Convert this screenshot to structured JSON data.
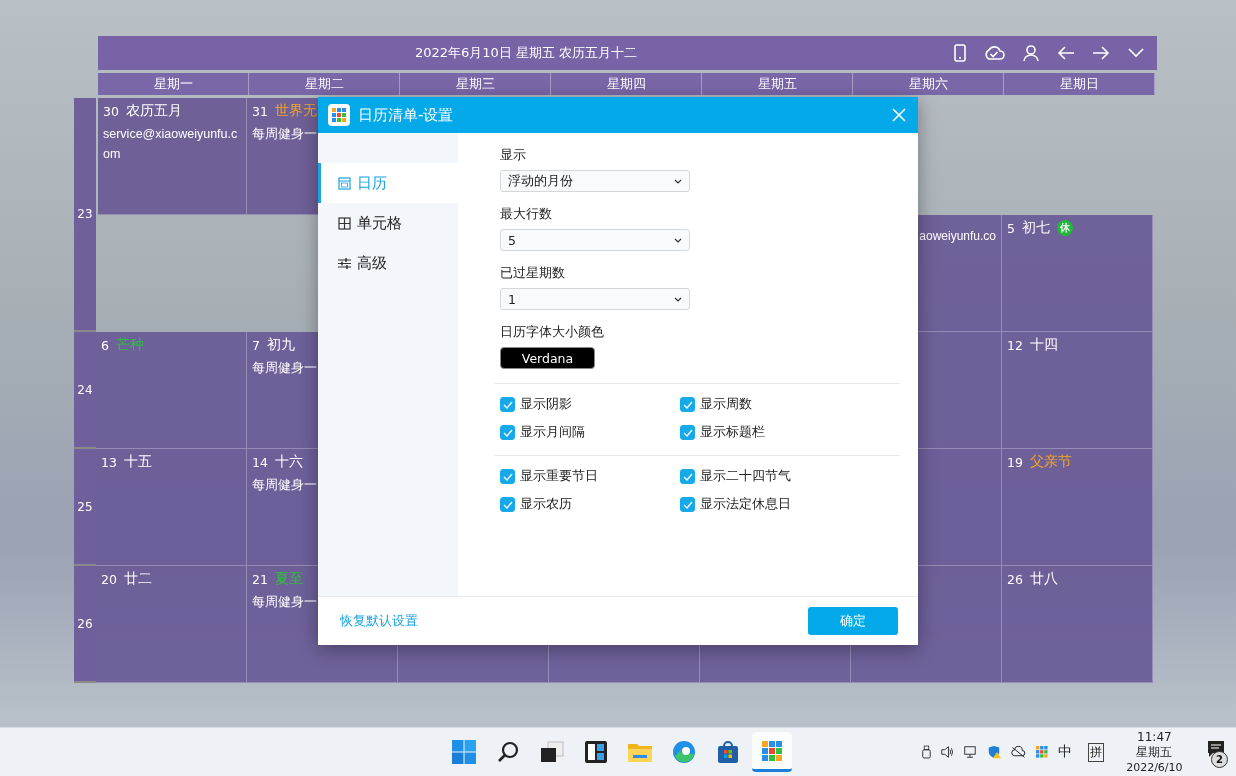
{
  "calendar": {
    "title": "2022年6月10日 星期五 农历五月十二",
    "toolbar": [
      {
        "kind": "phone"
      },
      {
        "kind": "cloud-check"
      },
      {
        "kind": "person"
      },
      {
        "kind": "arrow-left"
      },
      {
        "kind": "arrow-right"
      },
      {
        "kind": "chevron-down"
      }
    ],
    "weekdays": [
      "星期一",
      "星期二",
      "星期三",
      "星期四",
      "星期五",
      "星期六",
      "星期日"
    ],
    "weeks": [
      {
        "number": "23",
        "split": true,
        "days": [
          {
            "kind": "prev",
            "date": "30",
            "label": "农历五月",
            "color": "#ffffff",
            "event": "service@xiaoweiyunfu.com"
          },
          {
            "kind": "prev",
            "date": "31",
            "label": "世界无",
            "color": "#f5a623",
            "event": "每周健身一"
          },
          {
            "kind": "current"
          },
          {
            "kind": "current"
          },
          {
            "kind": "current"
          },
          {
            "kind": "current",
            "event": "aoweiyunfu.co",
            "covered": true
          },
          {
            "kind": "current",
            "date": "5",
            "label": "初七",
            "color": "#ffffff",
            "badge": "休"
          }
        ]
      },
      {
        "number": "24",
        "split": false,
        "days": [
          {
            "kind": "current",
            "date": "6",
            "label": "芒种",
            "color": "#2ec23a"
          },
          {
            "kind": "current",
            "date": "7",
            "label": "初九",
            "color": "#ffffff",
            "event": "每周健身一"
          },
          {
            "kind": "current"
          },
          {
            "kind": "current"
          },
          {
            "kind": "current"
          },
          {
            "kind": "current"
          },
          {
            "kind": "current",
            "date": "12",
            "label": "十四",
            "color": "#ffffff"
          }
        ]
      },
      {
        "number": "25",
        "split": false,
        "days": [
          {
            "kind": "current",
            "date": "13",
            "label": "十五",
            "color": "#ffffff"
          },
          {
            "kind": "current",
            "date": "14",
            "label": "十六",
            "color": "#ffffff",
            "event": "每周健身一"
          },
          {
            "kind": "current"
          },
          {
            "kind": "current"
          },
          {
            "kind": "current"
          },
          {
            "kind": "current"
          },
          {
            "kind": "current",
            "date": "19",
            "label": "父亲节",
            "color": "#f5a623"
          }
        ]
      },
      {
        "number": "26",
        "split": false,
        "days": [
          {
            "kind": "current",
            "date": "20",
            "label": "廿二",
            "color": "#ffffff"
          },
          {
            "kind": "current",
            "date": "21",
            "label": "夏至",
            "color": "#2ec23a",
            "event": "每周健身一"
          },
          {
            "kind": "current"
          },
          {
            "kind": "current"
          },
          {
            "kind": "current"
          },
          {
            "kind": "current"
          },
          {
            "kind": "current",
            "date": "26",
            "label": "廿八",
            "color": "#ffffff"
          }
        ]
      }
    ]
  },
  "dialog": {
    "title": "日历清单-设置",
    "sidebar": [
      {
        "label": "日历",
        "kind": "calendar",
        "selected": true
      },
      {
        "label": "单元格",
        "kind": "grid",
        "selected": false
      },
      {
        "label": "高级",
        "kind": "sliders",
        "selected": false
      }
    ],
    "fields": [
      {
        "label": "显示",
        "value": "浮动的月份"
      },
      {
        "label": "最大行数",
        "value": "5"
      },
      {
        "label": "已过星期数",
        "value": "1"
      }
    ],
    "font_setting": {
      "label": "日历字体大小颜色",
      "value": "Verdana"
    },
    "checkbox_groups": [
      [
        {
          "label": "显示阴影",
          "checked": true
        },
        {
          "label": "显示周数",
          "checked": true
        },
        {
          "label": "显示月间隔",
          "checked": true
        },
        {
          "label": "显示标题栏",
          "checked": true
        }
      ],
      [
        {
          "label": "显示重要节日",
          "checked": true
        },
        {
          "label": "显示二十四节气",
          "checked": true
        },
        {
          "label": "显示农历",
          "checked": true
        },
        {
          "label": "显示法定休息日",
          "checked": true
        }
      ]
    ],
    "reset_link": "恢复默认设置",
    "ok_button": "确定"
  },
  "taskbar": {
    "apps": [
      {
        "kind": "start",
        "selected": false
      },
      {
        "kind": "search",
        "selected": false
      },
      {
        "kind": "taskview",
        "selected": false
      },
      {
        "kind": "widgets",
        "selected": false
      },
      {
        "kind": "explorer",
        "selected": false
      },
      {
        "kind": "edge",
        "selected": false
      },
      {
        "kind": "store",
        "selected": false
      },
      {
        "kind": "calendar-app",
        "selected": true
      }
    ],
    "tray": [
      {
        "kind": "usb"
      },
      {
        "kind": "volume"
      },
      {
        "kind": "network"
      },
      {
        "kind": "security"
      },
      {
        "kind": "cloud"
      },
      {
        "kind": "app"
      }
    ],
    "ime_mode": "中",
    "ime": "拼",
    "time": "11:47",
    "weekday": "星期五",
    "date": "2022/6/10",
    "notifications": "2"
  }
}
